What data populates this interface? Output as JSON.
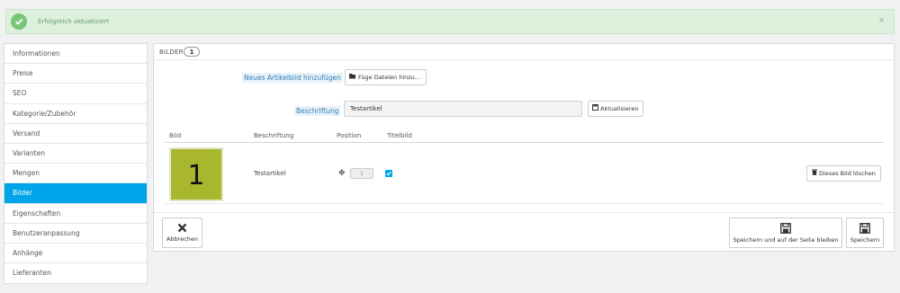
{
  "alert": {
    "message": "Erfolgreich aktualisiert",
    "close": "×"
  },
  "sidebar": {
    "items": [
      {
        "label": "Informationen"
      },
      {
        "label": "Preise"
      },
      {
        "label": "SEO"
      },
      {
        "label": "Kategorie/Zubehör"
      },
      {
        "label": "Versand"
      },
      {
        "label": "Varianten"
      },
      {
        "label": "Mengen"
      },
      {
        "label": "Bilder"
      },
      {
        "label": "Eigenschaften"
      },
      {
        "label": "Benutzeranpassung"
      },
      {
        "label": "Anhänge"
      },
      {
        "label": "Lieferanten"
      }
    ],
    "active": "Bilder"
  },
  "panel": {
    "title": "BILDER",
    "count": "1",
    "add_label": "Neues Artikelbild hinzufügen",
    "add_button": "Füge Dateien hinzu...",
    "caption_label": "Beschriftung",
    "caption_value": "Testartikel",
    "update_button": "Aktualisieren"
  },
  "table": {
    "headers": [
      "Bild",
      "Beschriftung",
      "Position",
      "Titelbild"
    ],
    "row": {
      "thumb_text": "1",
      "caption": "Testartikel",
      "position": "1",
      "cover": true,
      "delete_button": "Dieses Bild löschen"
    }
  },
  "footer": {
    "cancel": "Abbrechen",
    "save_stay": "Speichern und auf der Seite bleiben",
    "save": "Speichern"
  },
  "colors": {
    "accent": "#00a4e8",
    "success_bg": "#dcf0dc",
    "thumb_bg": "#a8b72e"
  }
}
